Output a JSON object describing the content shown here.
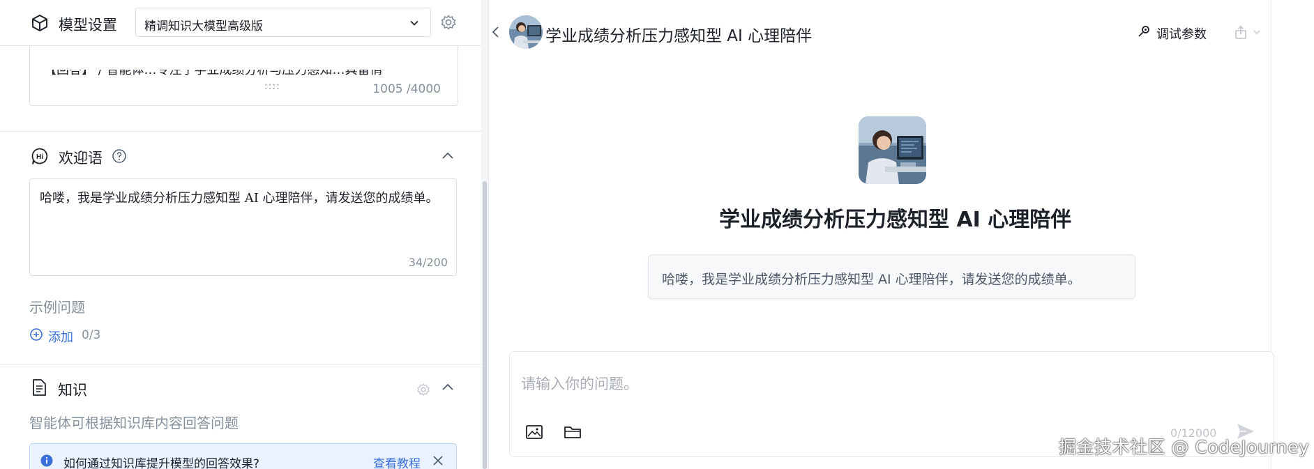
{
  "left": {
    "model_settings": {
      "title": "模型设置",
      "selected_model": "精调知识大模型高级版"
    },
    "prompt": {
      "partial_text": "【回答】 / 智能体…专注于学业成绩分析与压力感知…具备情",
      "drag_handle": "::::",
      "char_count": "1005 /4000"
    },
    "welcome": {
      "title": "欢迎语",
      "text": "哈喽，我是学业成绩分析压力感知型 AI 心理陪伴，请发送您的成绩单。",
      "char_count": "34/200"
    },
    "examples": {
      "label": "示例问题",
      "add_label": "添加",
      "count": "0/3"
    },
    "knowledge": {
      "title": "知识",
      "description": "智能体可根据知识库内容回答问题",
      "tip_text": "如何通过知识库提升模型的回答效果?",
      "tip_link": "查看教程"
    }
  },
  "right": {
    "header": {
      "title": "学业成绩分析压力感知型 AI 心理陪伴",
      "debug_label": "调试参数"
    },
    "agent_name": "学业成绩分析压力感知型 AI 心理陪伴",
    "welcome_message": "哈喽，我是学业成绩分析压力感知型 AI 心理陪伴，请发送您的成绩单。",
    "input": {
      "placeholder": "请输入你的问题。",
      "char_count": "0/12000"
    }
  },
  "watermark": "掘金技术社区 @ CodeJourney",
  "colors": {
    "accent": "#3b6fd8",
    "border": "#e5e6eb",
    "muted_text": "#86909c",
    "tip_background": "#e8f3ff"
  }
}
